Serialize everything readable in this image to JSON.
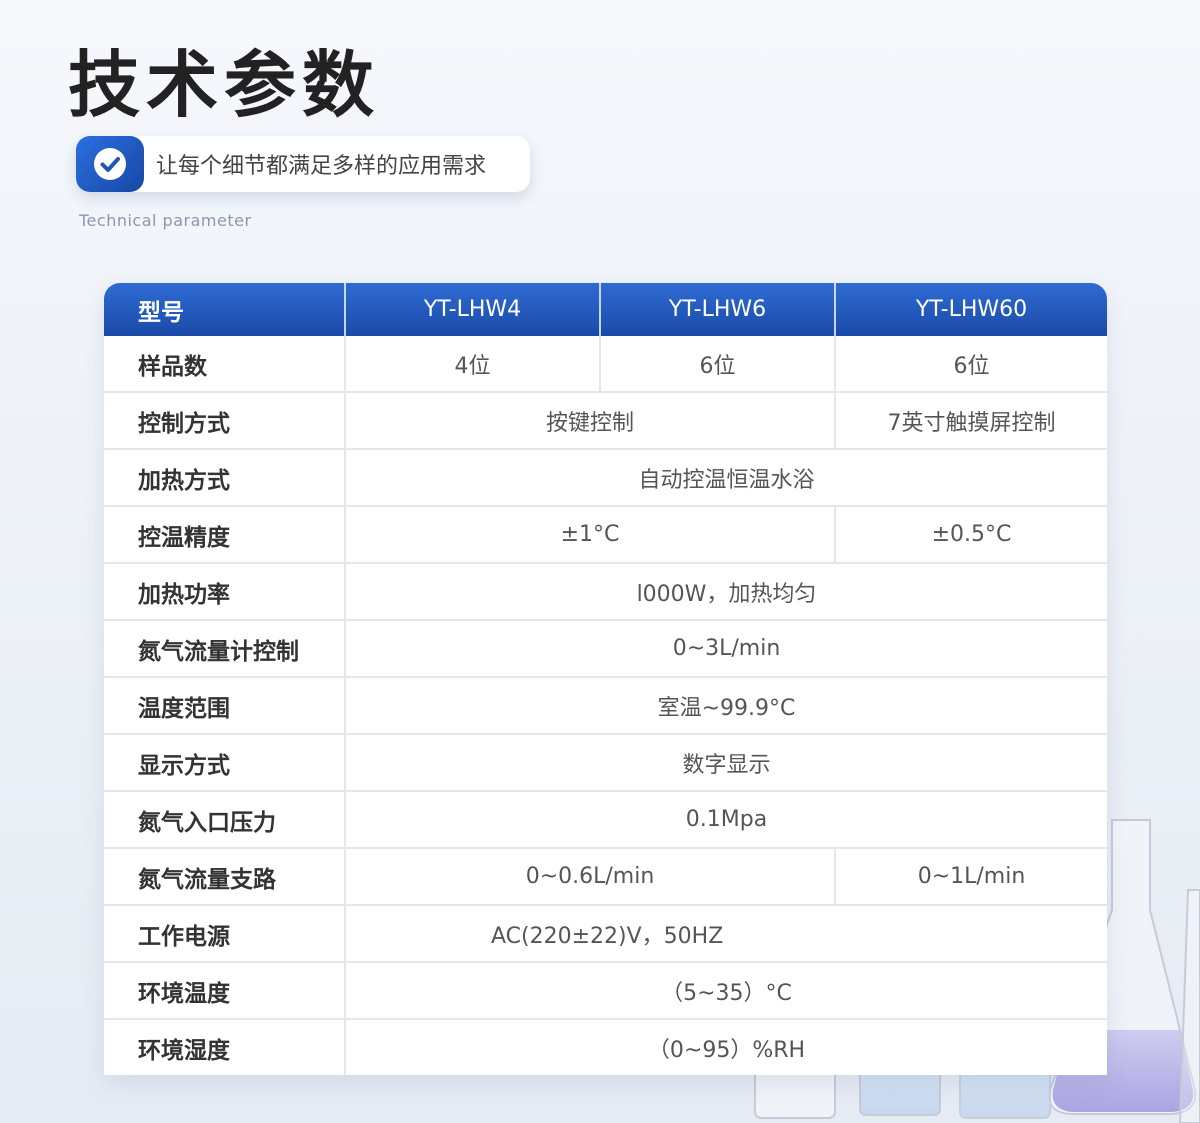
{
  "header": {
    "title": "技术参数",
    "tagline": "让每个细节都满足多样的应用需求",
    "subtitle_en": "Technical parameter"
  },
  "colors": {
    "accent": "#1f56b8",
    "background": "#eef2f8",
    "label_text": "#333333",
    "value_text": "#555555"
  },
  "icons": {
    "tagline_badge": "check-circle-icon"
  },
  "table": {
    "header": {
      "label": "型号",
      "models": [
        "YT-LHW4",
        "YT-LHW6",
        "YT-LHW60"
      ]
    },
    "rows": [
      {
        "label": "样品数",
        "values": [
          "4位",
          "6位",
          "6位"
        ]
      },
      {
        "label": "控制方式",
        "values": [
          "按键控制",
          "7英寸触摸屏控制"
        ]
      },
      {
        "label": "加热方式",
        "values": [
          "自动控温恒温水浴"
        ]
      },
      {
        "label": "控温精度",
        "values": [
          "±1°C",
          "±0.5°C"
        ]
      },
      {
        "label": "加热功率",
        "values": [
          "l000W，加热均匀"
        ]
      },
      {
        "label": "氮气流量计控制",
        "values": [
          "0~3L/min"
        ]
      },
      {
        "label": "温度范围",
        "values": [
          "室温~99.9°C"
        ]
      },
      {
        "label": "显示方式",
        "values": [
          "数字显示"
        ]
      },
      {
        "label": "氮气入口压力",
        "values": [
          "0.1Mpa"
        ]
      },
      {
        "label": "氮气流量支路",
        "values": [
          "0~0.6L/min",
          "0~1L/min"
        ]
      },
      {
        "label": "工作电源",
        "values": [
          "AC(220±22)V，50HZ"
        ]
      },
      {
        "label": "环境温度",
        "values": [
          "（5~35）°C"
        ]
      },
      {
        "label": "环境湿度",
        "values": [
          "（0~95）%RH"
        ]
      }
    ]
  }
}
